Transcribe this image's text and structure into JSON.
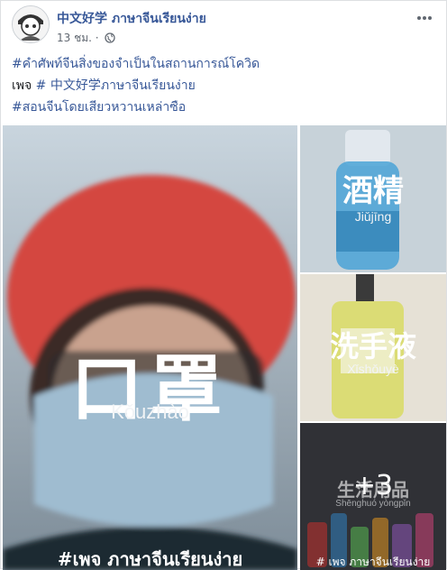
{
  "post": {
    "author": "中文好学 ภาษาจีนเรียนง่าย",
    "time": "13 ชม.",
    "dot": "·",
    "hashtag1": "#คำศัพท์จีนสิ่งของจำเป็นในสถานการณ์โควิด",
    "page_label": "เพจ",
    "hashtag_page": "# 中文好学ภาษาจีนเรียนง่าย",
    "hashtag2": "#สอนจีนโดยเสียวหวานเหล่าซือ",
    "icons": [
      "globe-icon",
      "more-options-icon"
    ]
  },
  "photos": [
    {
      "hanzi": "口罩",
      "pinyin": "Kǒuzhào",
      "watermark": "#เพจ ภาษาจีนเรียนง่าย"
    },
    {
      "hanzi": "酒精",
      "pinyin": "Jiǔjīng"
    },
    {
      "hanzi": "洗手液",
      "pinyin": "Xǐshǒuyè"
    },
    {
      "hanzi": "生活用品",
      "pinyin": "Shēnghuó yòngpǐn",
      "more_count": "+3",
      "watermark": "# เพจ ภาษาจีนเรียนง่าย"
    }
  ],
  "colors": {
    "link": "#385898",
    "meta": "#606770",
    "helmet": "#d4463f",
    "mask": "#9fbcd0",
    "soap": "#d9dc6a",
    "bottle": "#4aa3d6"
  }
}
